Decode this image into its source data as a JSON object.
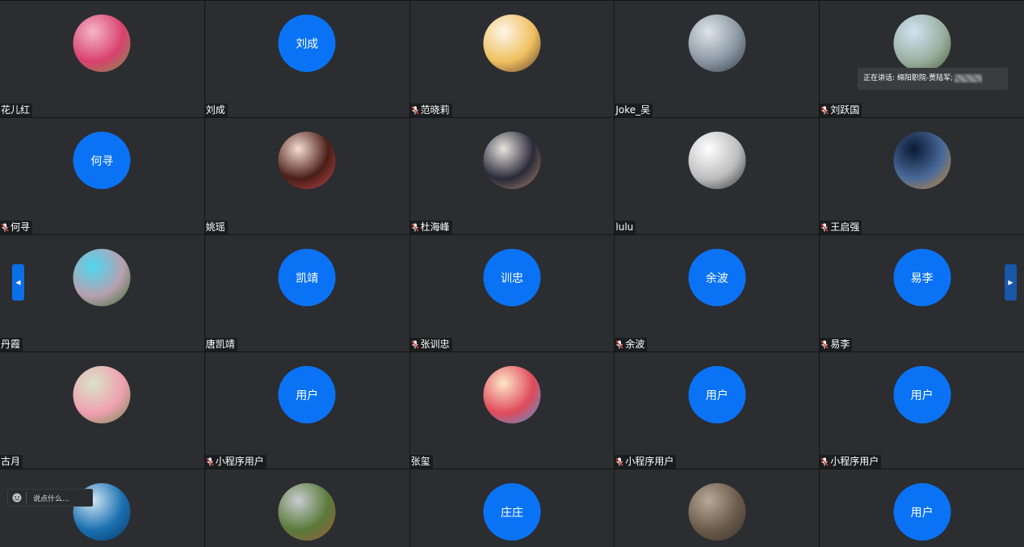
{
  "participants": [
    {
      "name": "花儿红",
      "avatar": {
        "type": "photo",
        "desc": "pink-roses",
        "colors": [
          "#f4b6c8",
          "#d9416e",
          "#7a9a4a"
        ]
      },
      "mic": false
    },
    {
      "name": "刘成",
      "avatar": {
        "type": "text",
        "text": "刘成"
      },
      "mic": false
    },
    {
      "name": "范晓莉",
      "avatar": {
        "type": "photo",
        "desc": "cartoon-girl-reading",
        "colors": [
          "#fdf6ea",
          "#f0c060",
          "#5a3a2a"
        ]
      },
      "mic": true
    },
    {
      "name": "Joke_吴",
      "avatar": {
        "type": "photo",
        "desc": "lake-landscape",
        "colors": [
          "#dfe5ea",
          "#8a97a3",
          "#2f3840"
        ]
      },
      "mic": false
    },
    {
      "name": "刘跃国",
      "avatar": {
        "type": "photo",
        "desc": "person-outdoors",
        "colors": [
          "#cfe3f5",
          "#9bb0a0",
          "#4a5a3a"
        ]
      },
      "mic": true
    },
    {
      "name": "何寻",
      "avatar": {
        "type": "text",
        "text": "何寻"
      },
      "mic": true
    },
    {
      "name": "姚瑶",
      "avatar": {
        "type": "photo",
        "desc": "cartoon-woman",
        "colors": [
          "#f7dcd0",
          "#4a1e18",
          "#c7484a"
        ]
      },
      "mic": false
    },
    {
      "name": "杜海峰",
      "avatar": {
        "type": "photo",
        "desc": "child-photo",
        "colors": [
          "#e8e4de",
          "#2a2a3a",
          "#b08a6a"
        ]
      },
      "mic": true
    },
    {
      "name": "lulu",
      "avatar": {
        "type": "photo",
        "desc": "woman-black-white",
        "colors": [
          "#ffffff",
          "#bdbdbd",
          "#2a2a2a"
        ]
      },
      "mic": false
    },
    {
      "name": "王启强",
      "avatar": {
        "type": "photo",
        "desc": "fountain-pen",
        "colors": [
          "#0a1a33",
          "#4a6a9a",
          "#d08a2a"
        ]
      },
      "mic": true
    },
    {
      "name": "丹霞",
      "avatar": {
        "type": "photo",
        "desc": "blossom-tree",
        "colors": [
          "#4fd7f0",
          "#b7a0b0",
          "#3a6a2a"
        ]
      },
      "mic": false
    },
    {
      "name": "唐凯靖",
      "avatar": {
        "type": "text",
        "text": "凯靖"
      },
      "mic": false
    },
    {
      "name": "张训忠",
      "avatar": {
        "type": "text",
        "text": "训忠"
      },
      "mic": true
    },
    {
      "name": "余波",
      "avatar": {
        "type": "text",
        "text": "余波"
      },
      "mic": true
    },
    {
      "name": "易李",
      "avatar": {
        "type": "text",
        "text": "易李"
      },
      "mic": true
    },
    {
      "name": "古月",
      "avatar": {
        "type": "photo",
        "desc": "lotus-flower",
        "colors": [
          "#d8e4c8",
          "#f0a0b0",
          "#6a8a4a"
        ]
      },
      "mic": false
    },
    {
      "name": "小程序用户",
      "avatar": {
        "type": "text",
        "text": "用户"
      },
      "mic": true
    },
    {
      "name": "张玺",
      "avatar": {
        "type": "photo",
        "desc": "cartoon-family",
        "colors": [
          "#fde7c8",
          "#e04a5a",
          "#4a9ad8"
        ]
      },
      "mic": false
    },
    {
      "name": "小程序用户",
      "avatar": {
        "type": "text",
        "text": "用户"
      },
      "mic": true
    },
    {
      "name": "小程序用户",
      "avatar": {
        "type": "text",
        "text": "用户"
      },
      "mic": true
    },
    {
      "name": "",
      "avatar": {
        "type": "photo",
        "desc": "lake-crater",
        "colors": [
          "#cfe6f5",
          "#1a6fb0",
          "#0a3a6a"
        ]
      },
      "mic": false
    },
    {
      "name": "",
      "avatar": {
        "type": "photo",
        "desc": "mountain-village",
        "colors": [
          "#c8ccd0",
          "#5a7a3a",
          "#a05a3a"
        ]
      },
      "mic": false
    },
    {
      "name": "",
      "avatar": {
        "type": "text",
        "text": "庄庄"
      },
      "mic": false
    },
    {
      "name": "",
      "avatar": {
        "type": "photo",
        "desc": "cat-photo",
        "colors": [
          "#b8a898",
          "#6a5a4a",
          "#3a3530"
        ]
      },
      "mic": false
    },
    {
      "name": "",
      "avatar": {
        "type": "text",
        "text": "用户"
      },
      "mic": false
    }
  ],
  "speaking_banner": {
    "text": "正在讲话: 绵阳职院-贾陆军;"
  },
  "chat": {
    "placeholder": "说点什么..."
  },
  "nav": {
    "left_icon": "chevron-left-icon",
    "right_icon": "chevron-right-icon"
  },
  "colors": {
    "avatar_text_bg": "#0a73f5",
    "tile_bg": "#2b2d31",
    "label_bg": "#1b1c1e",
    "mic_color": "#e2443a"
  }
}
